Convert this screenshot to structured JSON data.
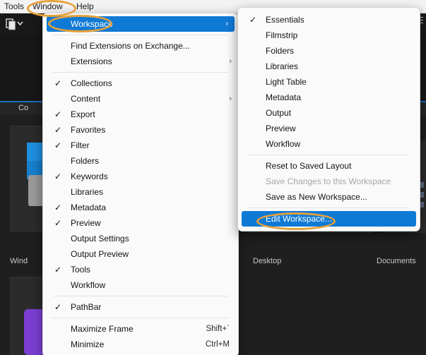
{
  "app": {
    "background_color": "#1e1e1e",
    "accent_blue": "#0f7ad6",
    "annotation_color": "#e5a03a",
    "panel_title": "Co",
    "window_label": "Wind",
    "thumb_labels": [
      "Desktop",
      "Documents"
    ],
    "icon_name": "copy-stack-icon",
    "menu_icon_name": "hamburger-icon"
  },
  "menubar": {
    "items": [
      {
        "label": "Tools",
        "annotated": false
      },
      {
        "label": "Window",
        "annotated": true
      },
      {
        "label": "Help",
        "annotated": false
      }
    ]
  },
  "window_menu": {
    "items": [
      {
        "label": "Workspace",
        "checked": false,
        "submenu": true,
        "highlighted": true,
        "annotated": true
      },
      {
        "separator": true
      },
      {
        "label": "Find Extensions on Exchange...",
        "checked": false,
        "submenu": false
      },
      {
        "label": "Extensions",
        "checked": false,
        "submenu": true
      },
      {
        "separator": true
      },
      {
        "label": "Collections",
        "checked": true,
        "submenu": false
      },
      {
        "label": "Content",
        "checked": false,
        "submenu": true
      },
      {
        "label": "Export",
        "checked": true,
        "submenu": false
      },
      {
        "label": "Favorites",
        "checked": true,
        "submenu": false
      },
      {
        "label": "Filter",
        "checked": true,
        "submenu": false
      },
      {
        "label": "Folders",
        "checked": false,
        "submenu": false
      },
      {
        "label": "Keywords",
        "checked": true,
        "submenu": false
      },
      {
        "label": "Libraries",
        "checked": false,
        "submenu": false
      },
      {
        "label": "Metadata",
        "checked": true,
        "submenu": false
      },
      {
        "label": "Preview",
        "checked": true,
        "submenu": false
      },
      {
        "label": "Output Settings",
        "checked": false,
        "submenu": false
      },
      {
        "label": "Output Preview",
        "checked": false,
        "submenu": false
      },
      {
        "label": "Tools",
        "checked": true,
        "submenu": false
      },
      {
        "label": "Workflow",
        "checked": false,
        "submenu": false
      },
      {
        "separator": true
      },
      {
        "label": "PathBar",
        "checked": true,
        "submenu": false
      },
      {
        "separator": true
      },
      {
        "label": "Maximize Frame",
        "checked": false,
        "submenu": false,
        "shortcut": "Shift+`"
      },
      {
        "label": "Minimize",
        "checked": false,
        "submenu": false,
        "shortcut": "Ctrl+M"
      }
    ]
  },
  "workspace_submenu": {
    "items": [
      {
        "label": "Essentials",
        "checked": true
      },
      {
        "label": "Filmstrip",
        "checked": false
      },
      {
        "label": "Folders",
        "checked": false
      },
      {
        "label": "Libraries",
        "checked": false
      },
      {
        "label": "Light Table",
        "checked": false
      },
      {
        "label": "Metadata",
        "checked": false
      },
      {
        "label": "Output",
        "checked": false
      },
      {
        "label": "Preview",
        "checked": false
      },
      {
        "label": "Workflow",
        "checked": false
      },
      {
        "separator": true
      },
      {
        "label": "Reset to Saved Layout",
        "checked": false
      },
      {
        "label": "Save Changes to this Workspace",
        "checked": false,
        "disabled": true
      },
      {
        "label": "Save as New Workspace...",
        "checked": false
      },
      {
        "separator": true
      },
      {
        "label": "Edit Workspace...",
        "checked": false,
        "highlighted": true,
        "annotated": true
      }
    ]
  },
  "glyphs": {
    "check": "✓",
    "chevron_right": "›",
    "chevron_down": "∨"
  }
}
